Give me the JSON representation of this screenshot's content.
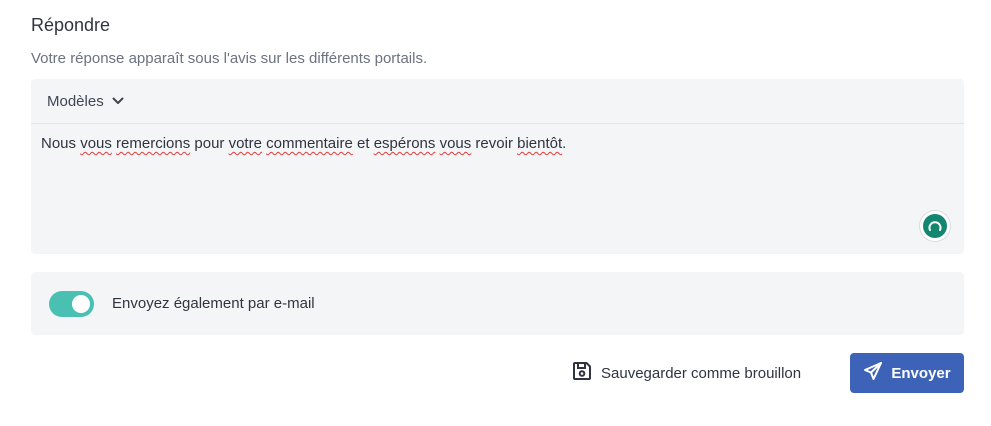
{
  "section": {
    "title": "Répondre",
    "subtitle": "Votre réponse apparaît sous l'avis sur les différents portails."
  },
  "editor": {
    "templates_label": "Modèles",
    "templates_icon": "chevron-down-icon",
    "text_words": [
      {
        "text": "Nous ",
        "misspelled": false
      },
      {
        "text": "vous",
        "misspelled": true
      },
      {
        "text": " ",
        "misspelled": false
      },
      {
        "text": "remercions",
        "misspelled": true
      },
      {
        "text": " pour ",
        "misspelled": false
      },
      {
        "text": "votre",
        "misspelled": true
      },
      {
        "text": " ",
        "misspelled": false
      },
      {
        "text": "commentaire",
        "misspelled": true
      },
      {
        "text": " et ",
        "misspelled": false
      },
      {
        "text": "espérons",
        "misspelled": true
      },
      {
        "text": " ",
        "misspelled": false
      },
      {
        "text": "vous",
        "misspelled": true
      },
      {
        "text": " revoir ",
        "misspelled": false
      },
      {
        "text": "bientôt",
        "misspelled": true
      },
      {
        "text": ".",
        "misspelled": false
      }
    ],
    "grammar_icon": "grammar-check-icon"
  },
  "email": {
    "toggle_on": true,
    "label": "Envoyez également par e-mail"
  },
  "actions": {
    "draft_label": "Sauvegarder comme brouillon",
    "draft_icon": "save-icon",
    "send_label": "Envoyer",
    "send_icon": "paper-plane-icon"
  },
  "colors": {
    "accent": "#3d63b8",
    "toggle": "#49c0b2",
    "grammar": "#12866e",
    "panel_bg": "#f4f5f7"
  }
}
